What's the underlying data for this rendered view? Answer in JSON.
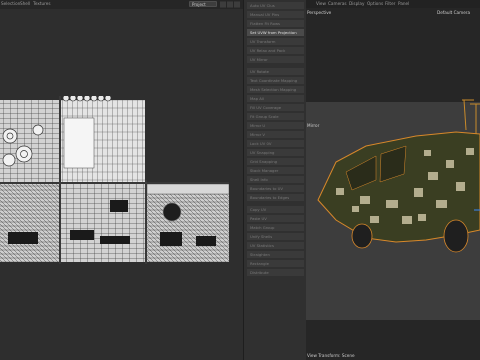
{
  "uv_editor": {
    "menu": [
      "Selection",
      "Shell",
      "Textures"
    ],
    "view_select": "Project"
  },
  "tool_panel": {
    "items": [
      {
        "label": "Auto UV Clus",
        "highlight": false
      },
      {
        "label": "Manual UV Pins",
        "highlight": false
      },
      {
        "label": "Flatten Fit Rows",
        "highlight": false
      },
      {
        "label": "Set UVW from Projection",
        "highlight": true
      },
      {
        "label": "UV Transform",
        "highlight": false
      },
      {
        "label": "UV Relax and Pack",
        "highlight": false
      },
      {
        "label": "UV Mirror",
        "highlight": false
      },
      {
        "label": "UV Rotate",
        "highlight": false
      },
      {
        "label": "Text Coordinate Mapping",
        "highlight": false
      },
      {
        "label": "Mesh Selection Mapping",
        "highlight": false
      },
      {
        "label": "Map All",
        "highlight": false
      },
      {
        "label": "Fill UV Coverage",
        "highlight": false
      },
      {
        "label": "Fit Group Scale",
        "highlight": false
      },
      {
        "label": "Mirror U",
        "highlight": false
      },
      {
        "label": "Mirror V",
        "highlight": false
      },
      {
        "label": "Lock UV 0V",
        "highlight": false
      },
      {
        "label": "UV Snapping",
        "highlight": false
      },
      {
        "label": "Grid Snapping",
        "highlight": false
      },
      {
        "label": "Stack Manager",
        "highlight": false
      },
      {
        "label": "Shell Info",
        "highlight": false
      },
      {
        "label": "Boundaries to UV",
        "highlight": false
      },
      {
        "label": "Boundaries to Edges",
        "highlight": false
      },
      {
        "label": "Copy UV",
        "highlight": false
      },
      {
        "label": "Paste UV",
        "highlight": false
      },
      {
        "label": "Match Group",
        "highlight": false
      },
      {
        "label": "Unify Shells",
        "highlight": false
      },
      {
        "label": "UV Statistics",
        "highlight": false
      },
      {
        "label": "Straighten",
        "highlight": false
      },
      {
        "label": "Rectangle",
        "highlight": false
      },
      {
        "label": "Distribute",
        "highlight": false
      }
    ]
  },
  "viewport": {
    "menu": [
      "View",
      "Cameras",
      "Display",
      "Options",
      "Filter",
      "Panel"
    ],
    "perspective_label": "Perspective",
    "camera_label": "Default Camera",
    "overlay_label": "Mirror",
    "footer_label": "View Transform: Scene"
  },
  "colors": {
    "uv_background": "#2e2e2e",
    "uv_shell_fill": "#d7d7d7",
    "uv_shell_line": "#3a3a3a",
    "vehicle_body": "#3a3e22",
    "vehicle_camo": "#b3ad8e",
    "selection_outline": "#d8882a",
    "viewport_background": "#3d3d3d"
  },
  "icons": [
    "camera-icon",
    "settings-icon",
    "grid-icon"
  ]
}
